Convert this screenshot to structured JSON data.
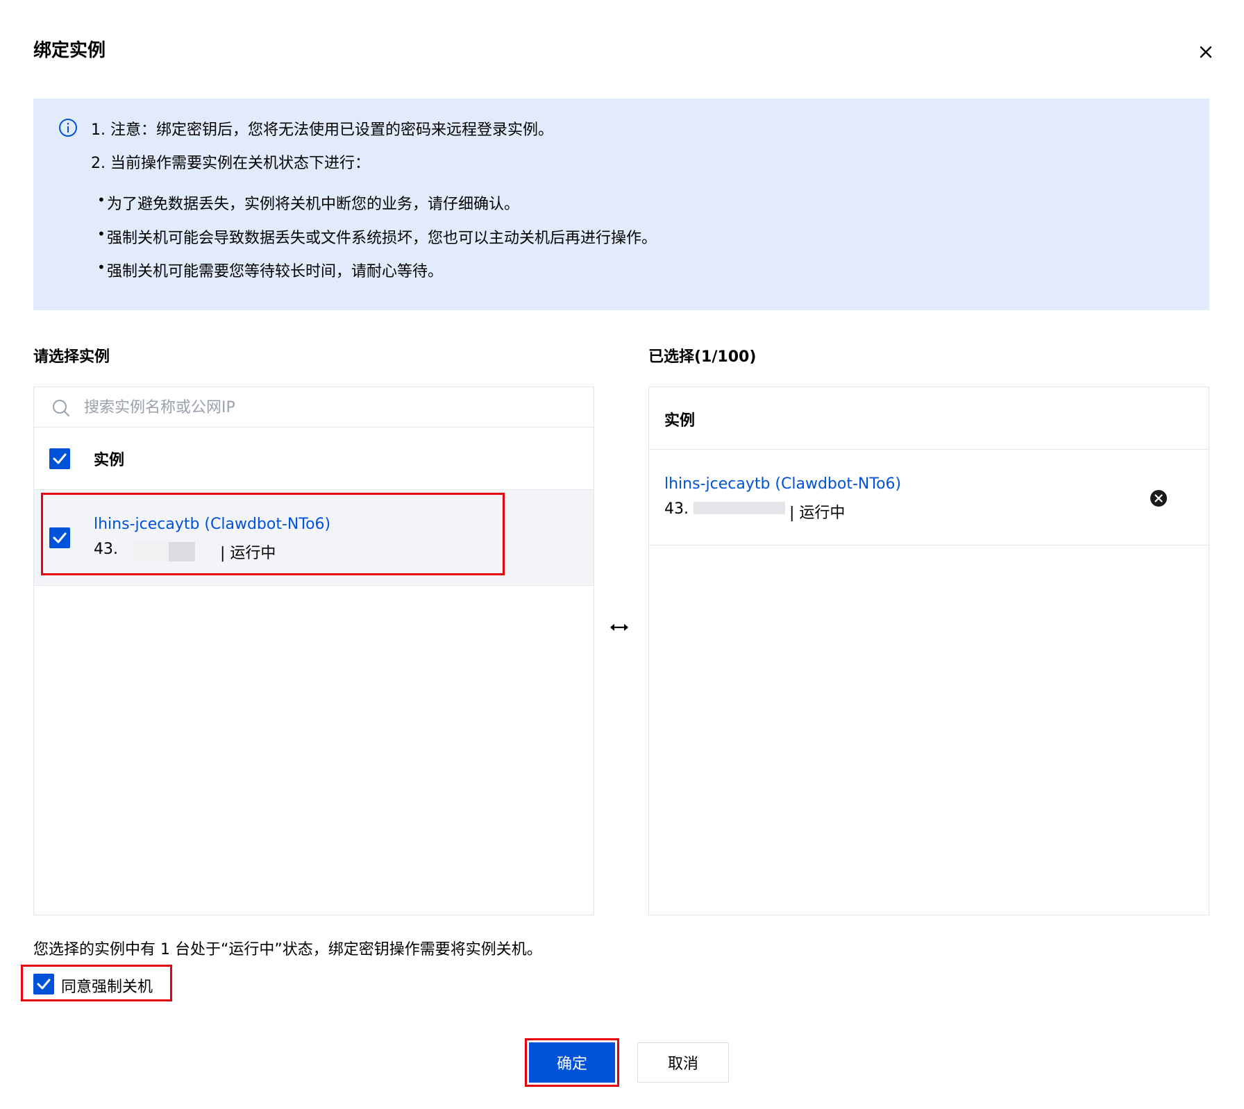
{
  "dialog": {
    "title": "绑定实例"
  },
  "notice": {
    "line1": "1. 注意：绑定密钥后，您将无法使用已设置的密码来远程登录实例。",
    "line2": "2. 当前操作需要实例在关机状态下进行：",
    "bullets": [
      "为了避免数据丢失，实例将关机中断您的业务，请仔细确认。",
      "强制关机可能会导致数据丢失或文件系统损坏，您也可以主动关机后再进行操作。",
      "强制关机可能需要您等待较长时间，请耐心等待。"
    ]
  },
  "left_panel": {
    "label": "请选择实例",
    "search_placeholder": "搜索实例名称或公网IP",
    "header": "实例",
    "items": [
      {
        "name": "lhins-jcecaytb (Clawdbot-NTo6)",
        "ip_prefix": "43.",
        "status": "| 运行中",
        "checked": true
      }
    ]
  },
  "right_panel": {
    "label": "已选择(1/100)",
    "header": "实例",
    "items": [
      {
        "name": "lhins-jcecaytb (Clawdbot-NTo6)",
        "ip_prefix": "43.",
        "status": "| 运行中"
      }
    ]
  },
  "footer": {
    "warning": "您选择的实例中有 1 台处于“运行中”状态，绑定密钥操作需要将实例关机。",
    "agree_label": "同意强制关机",
    "agree_checked": true,
    "confirm_label": "确定",
    "cancel_label": "取消"
  },
  "colors": {
    "primary": "#0052d9",
    "notice_bg": "#e2ebfc",
    "highlight": "#e8000f"
  },
  "icons": [
    "close-icon",
    "info-icon",
    "search-icon",
    "check-icon",
    "transfer-icon",
    "remove-icon"
  ]
}
